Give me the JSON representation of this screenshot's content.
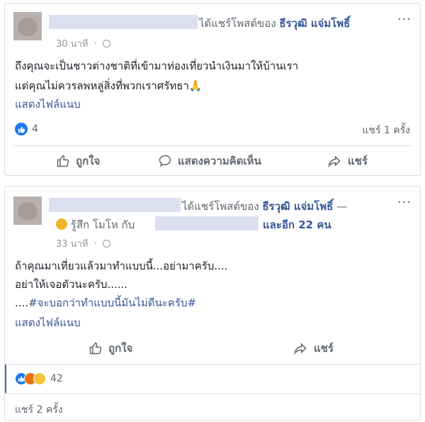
{
  "post1": {
    "shared_text": "ได้แชร์โพสต์ของ",
    "shared_author": "ธีรวุฒิ แจ่มโพธิ์",
    "time": "30 นาที",
    "menu": "···",
    "lines": [
      "ถึงคุณจะเป็นชาวต่างชาติที่เข้ามาท่องเที่ยวนำเงินมาให้บ้านเรา",
      "แต่คุณไม่ควรลพหลู่สิ่งที่พวกเราศรัทธา"
    ],
    "line2_emoji": "🙏",
    "show_attachment": "แสดงไฟล์แนบ",
    "like_count": "4",
    "share_count": "แชร์ 1 ครั้ง",
    "actions": {
      "like": "ถูกใจ",
      "comment": "แสดงความคิดเห็น",
      "share": "แชร์"
    }
  },
  "post2": {
    "shared_text": "ได้แชร์โพสต์ของ",
    "shared_author": "ธีรวุฒิ แจ่มโพธิ์",
    "dash": "—",
    "feeling": "รู้สึก โมโห กับ",
    "and_others": "และอีก 22 คน",
    "time": "33 นาที",
    "menu": "···",
    "lines": [
      "ถ้าคุณมาเที่ยวแล้วมาทำแบบนี้...อย่ามาครับ....",
      "อย่าให้เจอตัวนะครับ......"
    ],
    "hashtag_prefix": "....",
    "hashtag": "#จะบอกว่าทำแบบนี้มันไม่ดีนะครับ#",
    "show_attachment": "แสดงไฟล์แนบ",
    "actions": {
      "like": "ถูกใจ",
      "share": "แชร์"
    },
    "reaction_count": "42",
    "share_count": "แชร์ 2 ครั้ง"
  },
  "colors": {
    "link": "#365899",
    "meta": "#90949c",
    "like_blue": "#1877f2",
    "angry": "#e9710f",
    "haha": "#f5c33b"
  }
}
